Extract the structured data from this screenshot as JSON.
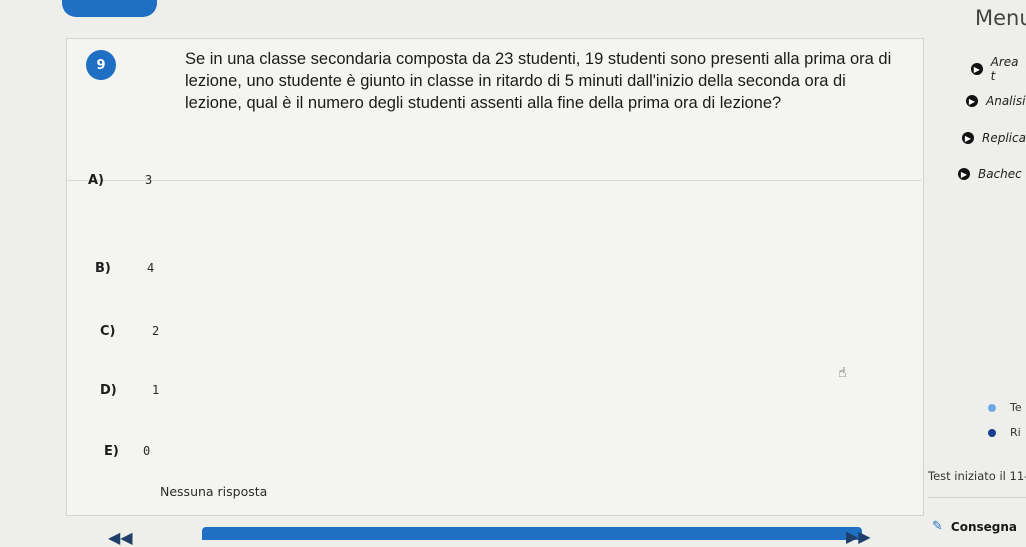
{
  "question": {
    "number": "9",
    "text": "Se in una classe secondaria composta da 23 studenti, 19 studenti sono presenti alla prima ora di lezione, uno studente è giunto in classe in ritardo di 5 minuti dall'inizio della seconda ora di lezione, qual è il numero degli studenti assenti alla fine della prima ora di lezione?"
  },
  "options": [
    {
      "letter": "A)",
      "value": "3"
    },
    {
      "letter": "B)",
      "value": "4"
    },
    {
      "letter": "C)",
      "value": "2"
    },
    {
      "letter": "D)",
      "value": "1"
    },
    {
      "letter": "E)",
      "value": "0"
    }
  ],
  "no_answer_label": "Nessuna risposta",
  "sidebar": {
    "menu_title": "Menu",
    "items": [
      {
        "label": "Area t"
      },
      {
        "label": "Analisi"
      },
      {
        "label": "Replica"
      },
      {
        "label": "Bachec"
      }
    ],
    "legend": [
      {
        "label": "Te",
        "color": "#6fa6e0"
      },
      {
        "label": "Ri",
        "color": "#1a3d8f"
      }
    ],
    "test_started": "Test iniziato il 11-",
    "submit_label": "Consegna"
  },
  "nav": {
    "prev_icon": "double-chevron-left-icon",
    "next_icon": "double-chevron-right-icon"
  },
  "colors": {
    "accent": "#1f6fc4"
  }
}
